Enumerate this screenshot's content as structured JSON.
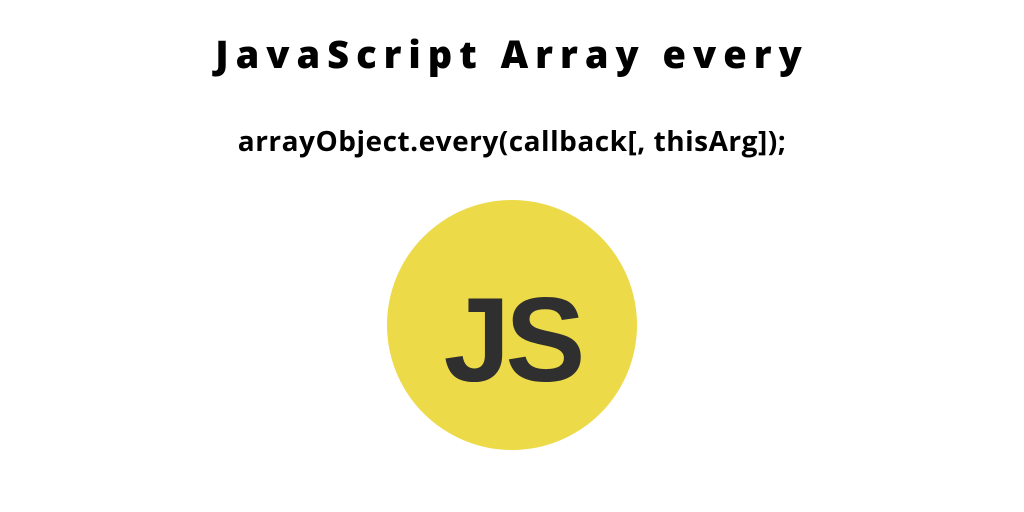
{
  "title": "JavaScript Array every",
  "code": "arrayObject.every(callback[, thisArg]);",
  "logo": {
    "text": "JS",
    "bg_color": "#ecda49",
    "fg_color": "#2f2f2f"
  }
}
